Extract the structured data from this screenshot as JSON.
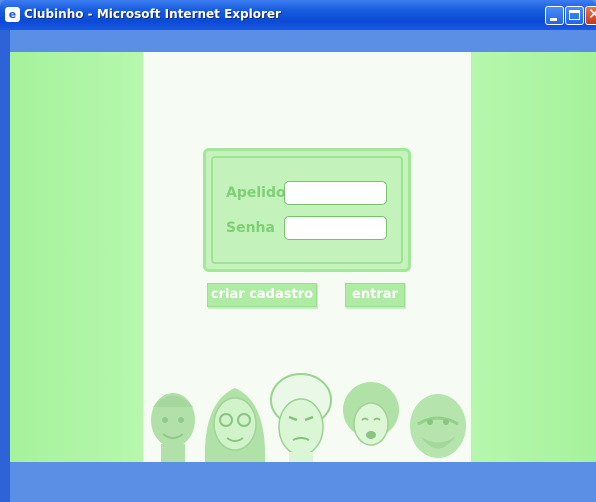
{
  "window": {
    "title": "Clubinho - Microsoft Internet Explorer",
    "icon": "ie-page-icon"
  },
  "login": {
    "nickname_label": "Apelido",
    "nickname_value": "",
    "password_label": "Senha",
    "password_value": ""
  },
  "actions": {
    "register_label": "criar cadastro",
    "enter_label": "entrar"
  },
  "colors": {
    "side_green": "#aaf5a0",
    "center_bg": "#f6fcf4",
    "label_green": "#7fcf77",
    "frame_blue": "#5b8fe6"
  }
}
